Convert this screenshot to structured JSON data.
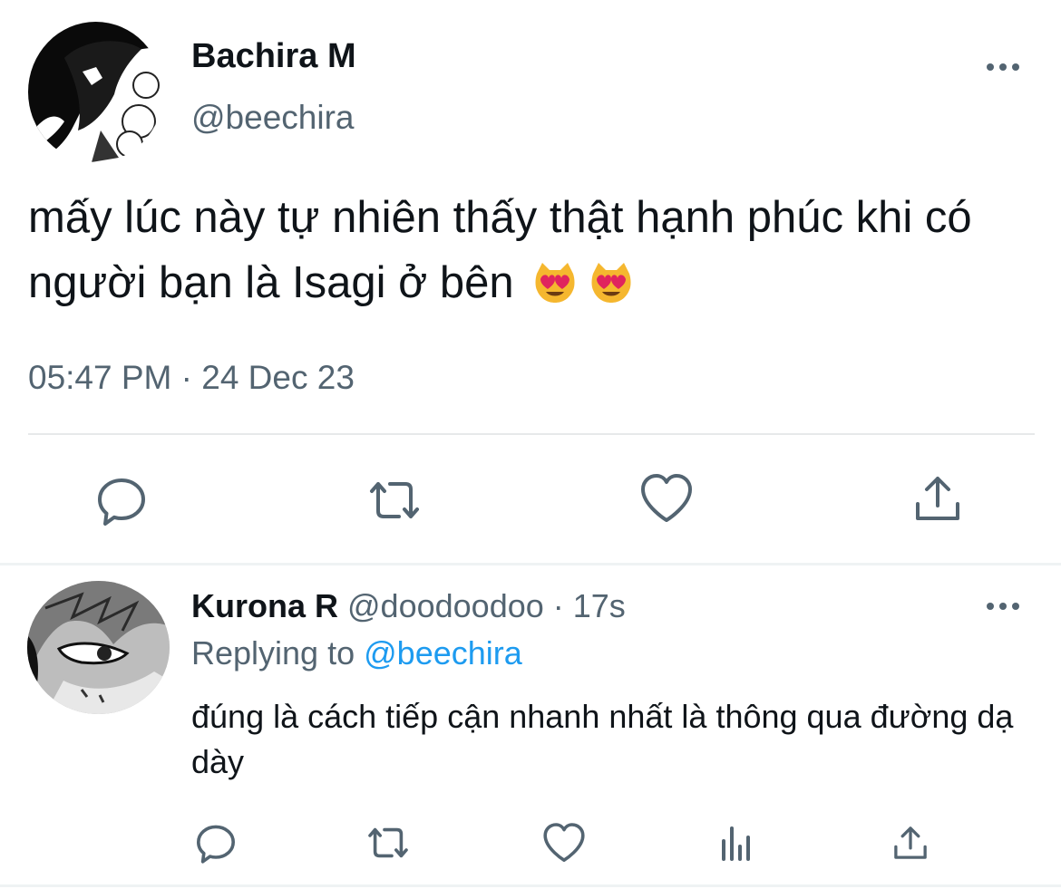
{
  "main_tweet": {
    "display_name": "Bachira M",
    "handle": "@beechira",
    "text": "mấy lúc này tự nhiên thấy thật hạnh phúc khi có người bạn là Isagi ở bên",
    "emoji": [
      "😻",
      "😻"
    ],
    "timestamp": "05:47 PM · 24 Dec 23",
    "actions": [
      "reply-icon",
      "retweet-icon",
      "like-icon",
      "share-icon"
    ]
  },
  "reply_tweet": {
    "display_name": "Kurona R",
    "handle_and_time": "@doodoodoo · 17s",
    "replying_to_label": "Replying to",
    "replying_to_mention": "@beechira",
    "text": "đúng là cách tiếp cận nhanh nhất là thông qua đường dạ dày",
    "actions": [
      "reply-icon",
      "retweet-icon",
      "like-icon",
      "views-icon",
      "share-icon"
    ]
  },
  "colors": {
    "text_primary": "#0f1419",
    "text_secondary": "#536471",
    "link": "#1d9bf0",
    "divider": "#e7e9ea"
  }
}
